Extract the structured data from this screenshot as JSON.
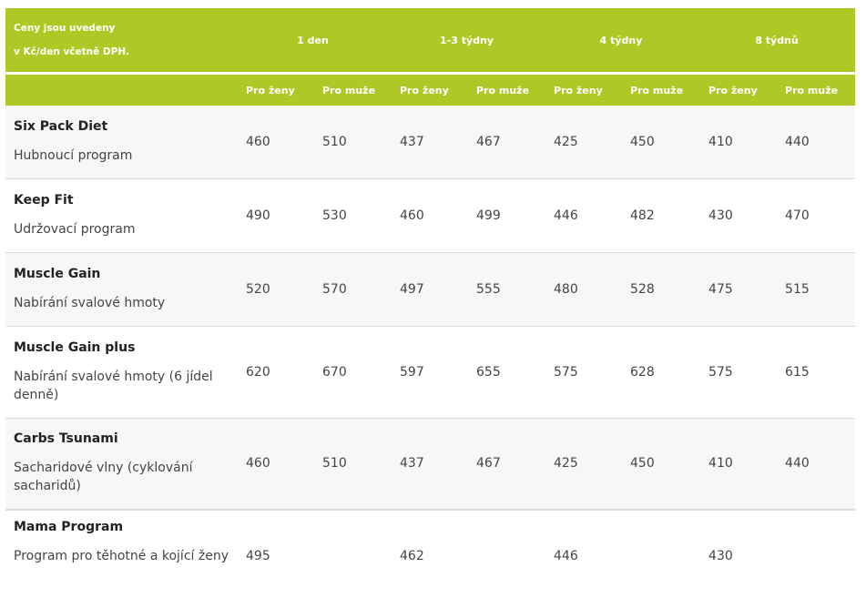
{
  "header": {
    "caption_line1": "Ceny jsou uvedeny",
    "caption_line2": "v Kč/den včetně DPH.",
    "periods": [
      "1 den",
      "1-3 týdny",
      "4 týdny",
      "8 týdnů"
    ],
    "sub_women": "Pro ženy",
    "sub_men": "Pro muže"
  },
  "accent_color": "#b0c826",
  "rows": [
    {
      "name": "Six Pack Diet",
      "desc": "Hubnoucí program",
      "prices": [
        "460",
        "510",
        "437",
        "467",
        "425",
        "450",
        "410",
        "440"
      ]
    },
    {
      "name": "Keep Fit",
      "desc": "Udržovací program",
      "prices": [
        "490",
        "530",
        "460",
        "499",
        "446",
        "482",
        "430",
        "470"
      ]
    },
    {
      "name": "Muscle Gain",
      "desc": "Nabírání svalové hmoty",
      "prices": [
        "520",
        "570",
        "497",
        "555",
        "480",
        "528",
        "475",
        "515"
      ]
    },
    {
      "name": "Muscle Gain plus",
      "desc": "Nabírání svalové hmoty (6 jídel denně)",
      "prices": [
        "620",
        "670",
        "597",
        "655",
        "575",
        "628",
        "575",
        "615"
      ]
    },
    {
      "name": "Carbs Tsunami",
      "desc": "Sacharidové vlny (cyklování sacharidů)",
      "prices": [
        "460",
        "510",
        "437",
        "467",
        "425",
        "450",
        "410",
        "440"
      ]
    },
    {
      "name": "Mama Program",
      "desc": "Program pro těhotné a kojící ženy",
      "prices": [
        "495",
        "",
        "462",
        "",
        "446",
        "",
        "430",
        ""
      ]
    }
  ]
}
